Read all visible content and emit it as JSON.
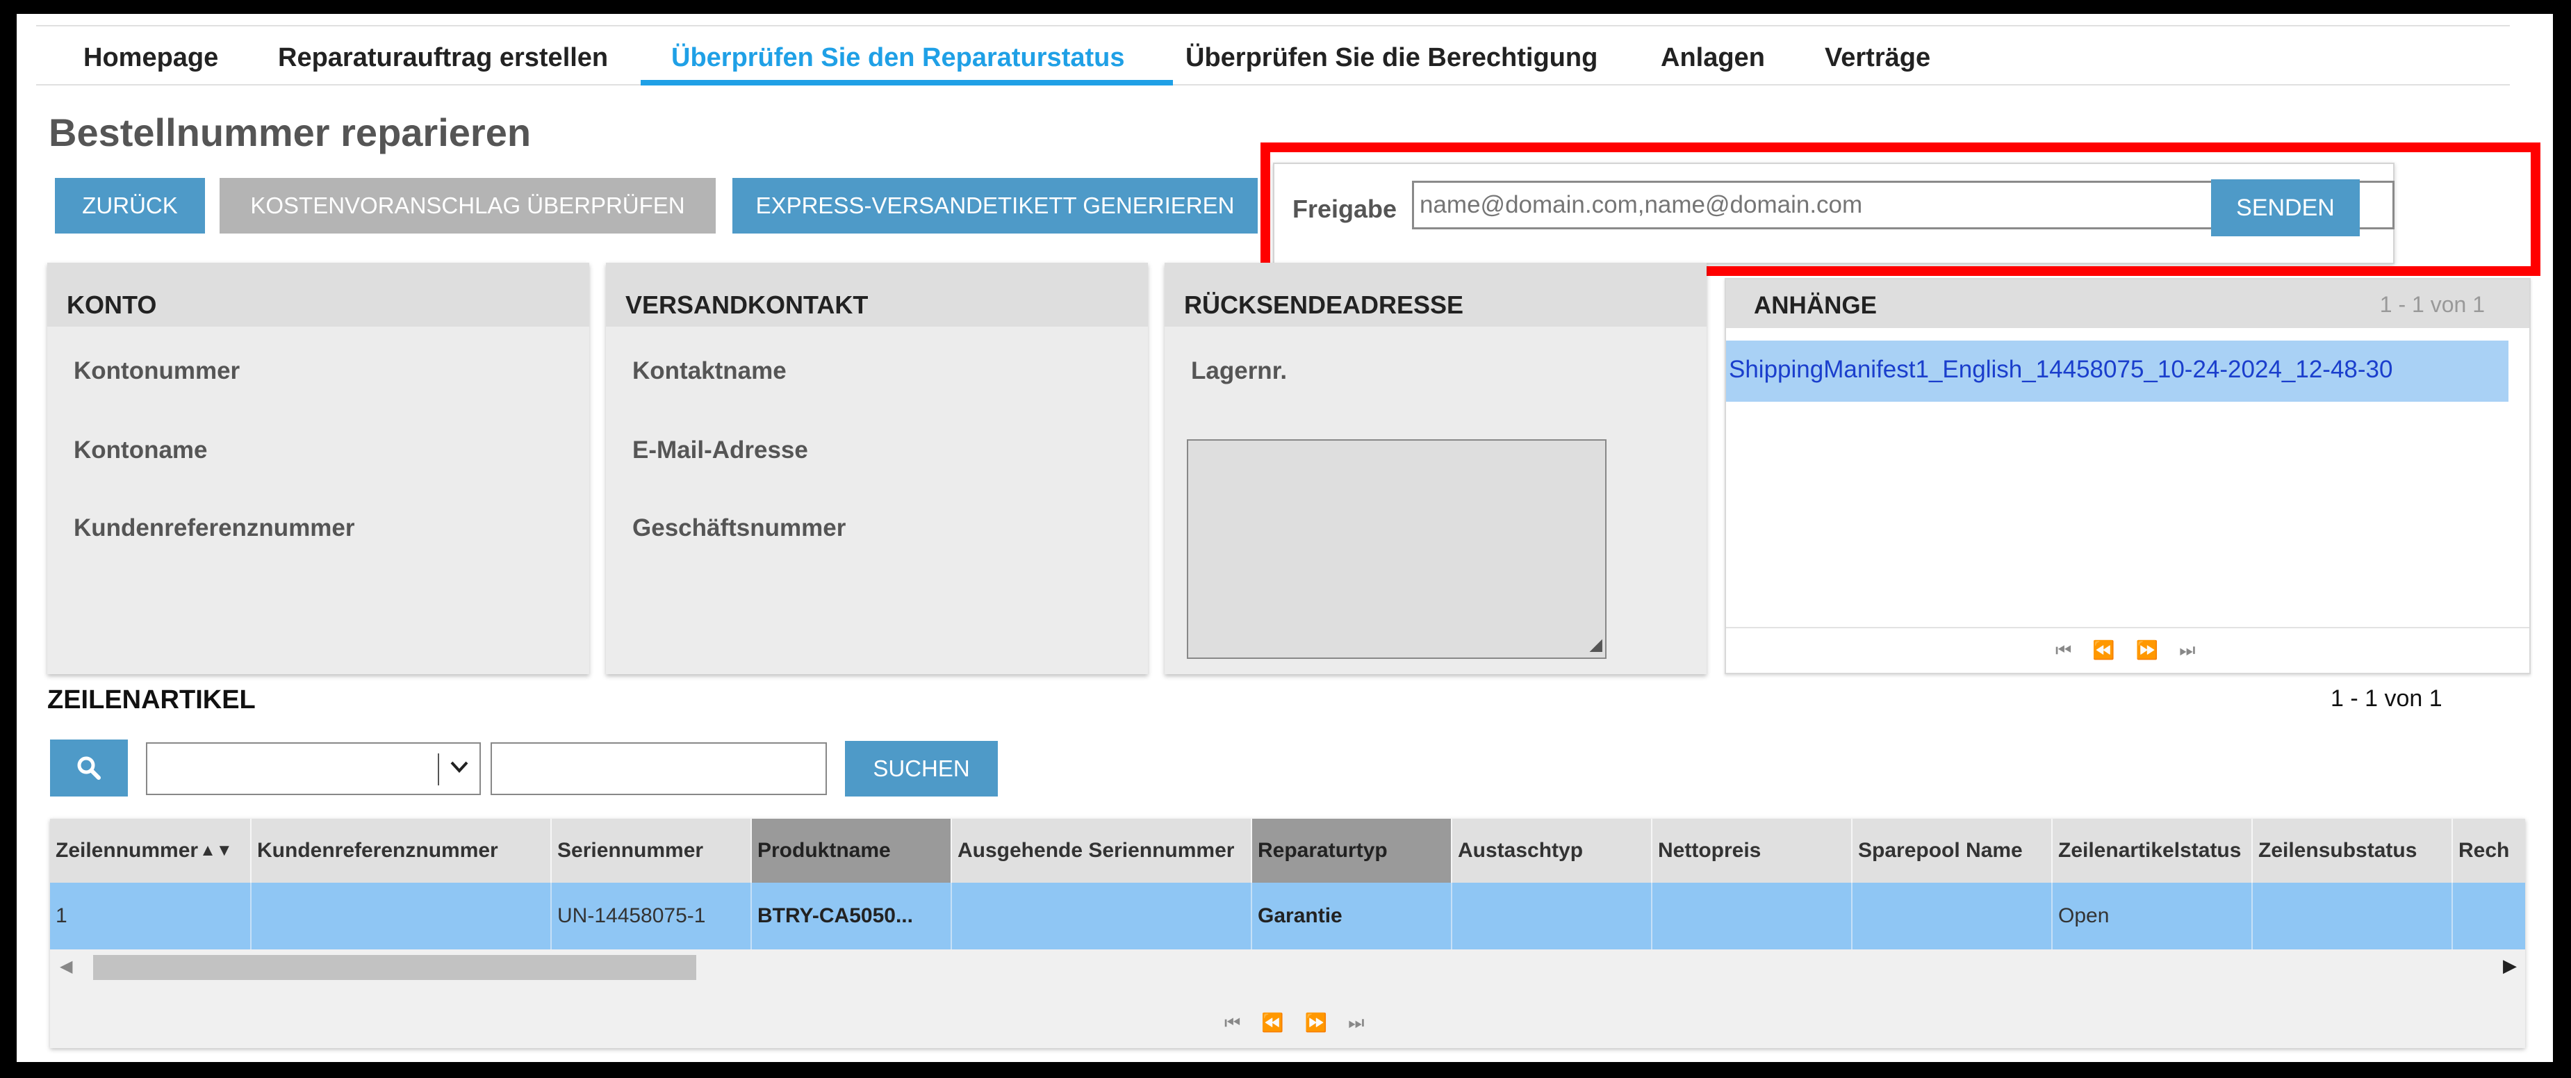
{
  "nav": {
    "items": [
      "Homepage",
      "Reparaturauftrag erstellen",
      "Überprüfen Sie den Reparaturstatus",
      "Überprüfen Sie die Berechtigung",
      "Anlagen",
      "Verträge"
    ]
  },
  "page": {
    "title": "Bestellnummer reparieren"
  },
  "toolbar": {
    "back_label": "ZURÜCK",
    "quote_label": "KOSTENVORANSCHLAG ÜBERPRÜFEN",
    "express_label": "EXPRESS-VERSANDETIKETT GENERIEREN"
  },
  "share": {
    "label": "Freigabe",
    "placeholder": "name@domain.com,name@domain.com",
    "send_label": "SENDEN"
  },
  "panels": {
    "konto": {
      "title": "KONTO",
      "fields": [
        "Kontonummer",
        "Kontoname",
        "Kundenreferenznummer"
      ]
    },
    "versand": {
      "title": "VERSANDKONTAKT",
      "fields": [
        "Kontaktname",
        "E-Mail-Adresse",
        "Geschäftsnummer"
      ]
    },
    "ruecksende": {
      "title": "RÜCKSENDEADRESSE",
      "fields": [
        "Lagernr."
      ]
    }
  },
  "attachments": {
    "title": "ANHÄNGE",
    "count": "1 - 1 von 1",
    "items": [
      "ShippingManifest1_English_14458075_10-24-2024_12-48-30"
    ]
  },
  "line_items": {
    "title": "ZEILENARTIKEL",
    "count": "1 - 1 von 1",
    "search_label": "SUCHEN",
    "columns": [
      "Zeilennummer",
      "Kundenreferenznummer",
      "Seriennummer",
      "Produktname",
      "Ausgehende Seriennummer",
      "Reparaturtyp",
      "Austaschtyp",
      "Nettopreis",
      "Sparepool Name",
      "Zeilenartikelstatus",
      "Zeilensubstatus",
      "Rech"
    ],
    "sort_indicator": "▲▼",
    "rows": [
      [
        "1",
        "",
        "UN-14458075-1",
        "BTRY-CA5050...",
        "",
        "Garantie",
        "",
        "",
        "",
        "Open",
        "",
        ""
      ]
    ]
  },
  "icons": {
    "search": "search-icon",
    "pager": [
      "first-page-icon",
      "prev-page-icon",
      "next-page-icon",
      "last-page-icon"
    ]
  },
  "colors": {
    "accent": "#1fa0e6",
    "button_blue": "#4e9ac8",
    "button_disabled": "#b4b4b4",
    "selected_row": "#8fc6f4",
    "highlight_frame": "#ff0000"
  }
}
